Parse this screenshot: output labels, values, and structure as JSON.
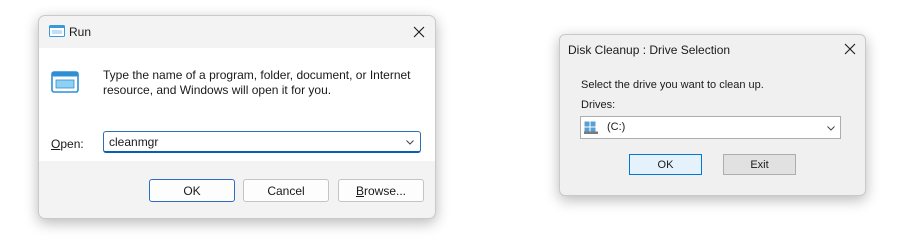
{
  "run_dialog": {
    "title": "Run",
    "description": "Type the name of a program, folder, document, or Internet resource, and Windows will open it for you.",
    "open_label_prefix": "",
    "open_label_underlined": "O",
    "open_label_rest": "pen:",
    "open_value": "cleanmgr",
    "ok_label": "OK",
    "cancel_label": "Cancel",
    "browse_label_underlined": "B",
    "browse_label_rest": "rowse...",
    "icons": {
      "title": "run-app-icon",
      "main": "run-app-icon",
      "close": "close-icon",
      "dropdown": "chevron-down-icon"
    }
  },
  "disk_cleanup_dialog": {
    "title": "Disk Cleanup : Drive Selection",
    "instruction": "Select the drive you want to clean up.",
    "drives_label": "Drives:",
    "selected_drive": "(C:)",
    "ok_label": "OK",
    "exit_label": "Exit",
    "icons": {
      "close": "close-icon",
      "drive": "hard-drive-icon",
      "dropdown": "chevron-down-icon"
    }
  },
  "colors": {
    "accent": "#0a5fb4",
    "run_icon_blue": "#3a9ad9",
    "window_bg": "#f3f3f3",
    "content_bg": "#ffffff"
  }
}
